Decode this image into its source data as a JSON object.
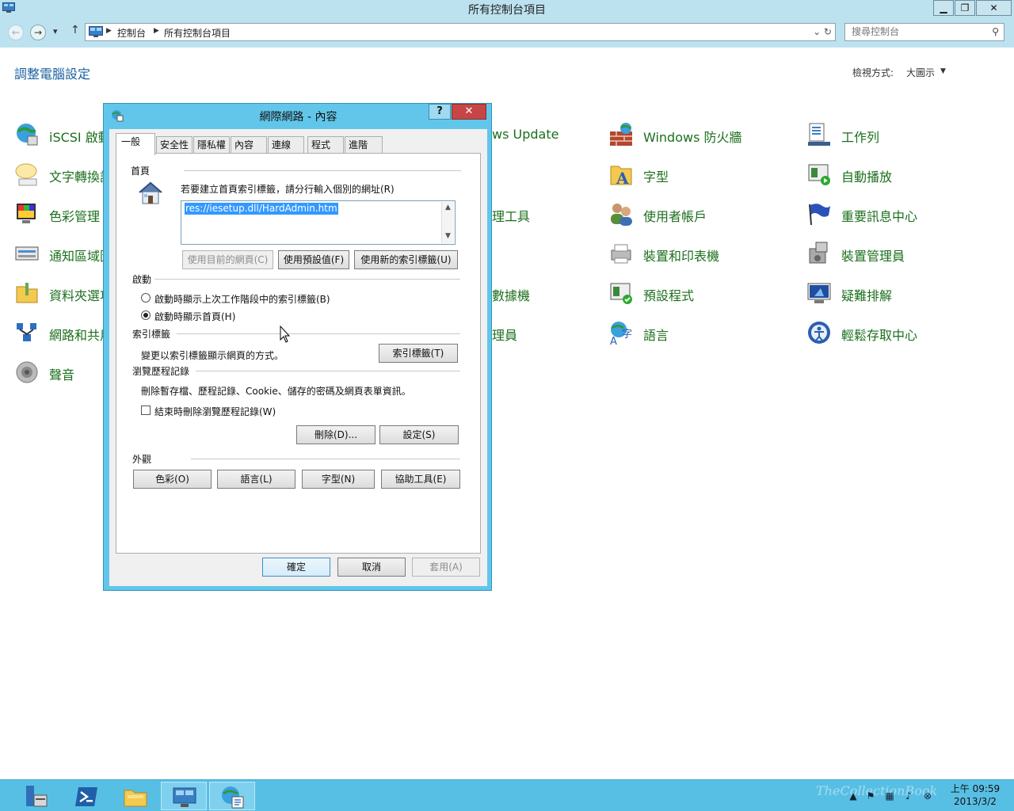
{
  "window": {
    "title": "所有控制台項目",
    "minimize_label": "▁",
    "restore_label": "❐",
    "close_label": "✕"
  },
  "nav": {
    "back_label": "←",
    "forward_label": "→",
    "recent_label": "▾",
    "up_label": "↑"
  },
  "breadcrumb": [
    "控制台",
    "所有控制台項目"
  ],
  "address_tools": "⌄  ↻",
  "search": {
    "placeholder": "搜尋控制台"
  },
  "page": {
    "heading": "調整電腦設定",
    "view_by_label": "檢視方式:",
    "view_by_value": "大圖示"
  },
  "items": {
    "iscsi": "iSCSI 啟動",
    "speech": "文字轉換語",
    "color": "色彩管理",
    "notify": "通知區域圖",
    "folder": "資料夾選項",
    "network": "網路和共用",
    "sound": "聲音",
    "windows_update": "ws Update",
    "admin_tools": "理工具",
    "sensor": "數據機",
    "admin2": "理員",
    "firewall": "Windows 防火牆",
    "fonts": "字型",
    "user_accounts": "使用者帳戶",
    "devices_printers": "裝置和印表機",
    "default_programs": "預設程式",
    "language": "語言",
    "taskbar_tools": "工作列",
    "autoplay": "自動播放",
    "action_center": "重要訊息中心",
    "device_manager": "裝置管理員",
    "troubleshoot": "疑難排解",
    "ease_access": "輕鬆存取中心"
  },
  "dialog": {
    "title": "網際網路 - 內容",
    "help_label": "?",
    "close_label": "✕",
    "tabs": [
      "一般",
      "安全性",
      "隱私權",
      "內容",
      "連線",
      "程式",
      "進階"
    ],
    "homepage": {
      "group": "首頁",
      "instruction": "若要建立首頁索引標籤，請分行輸入個別的網址(R)",
      "url": "res://iesetup.dll/HardAdmin.htm",
      "btn_current": "使用目前的網頁(C)",
      "btn_default": "使用預設值(F)",
      "btn_new_tab": "使用新的索引標籤(U)"
    },
    "startup": {
      "group": "啟動",
      "option_last_session": "啟動時顯示上次工作階段中的索引標籤(B)",
      "option_homepage": "啟動時顯示首頁(H)"
    },
    "tabs_group": {
      "group": "索引標籤",
      "description": "變更以索引標籤顯示網頁的方式。",
      "btn_tabs": "索引標籤(T)"
    },
    "history": {
      "group": "瀏覽歷程記錄",
      "description": "刪除暫存檔、歷程記錄、Cookie、儲存的密碼及網頁表單資訊。",
      "checkbox_delete_on_exit": "結束時刪除瀏覽歷程記錄(W)",
      "btn_delete": "刪除(D)...",
      "btn_settings": "設定(S)"
    },
    "appearance": {
      "group": "外觀",
      "btn_colors": "色彩(O)",
      "btn_languages": "語言(L)",
      "btn_fonts": "字型(N)",
      "btn_accessibility": "協助工具(E)"
    },
    "footer": {
      "ok": "確定",
      "cancel": "取消",
      "apply": "套用(A)"
    }
  },
  "taskbar": {
    "clock_time": "上午 09:59",
    "clock_date": "2013/3/2",
    "watermark": "TheCollectionBook"
  }
}
